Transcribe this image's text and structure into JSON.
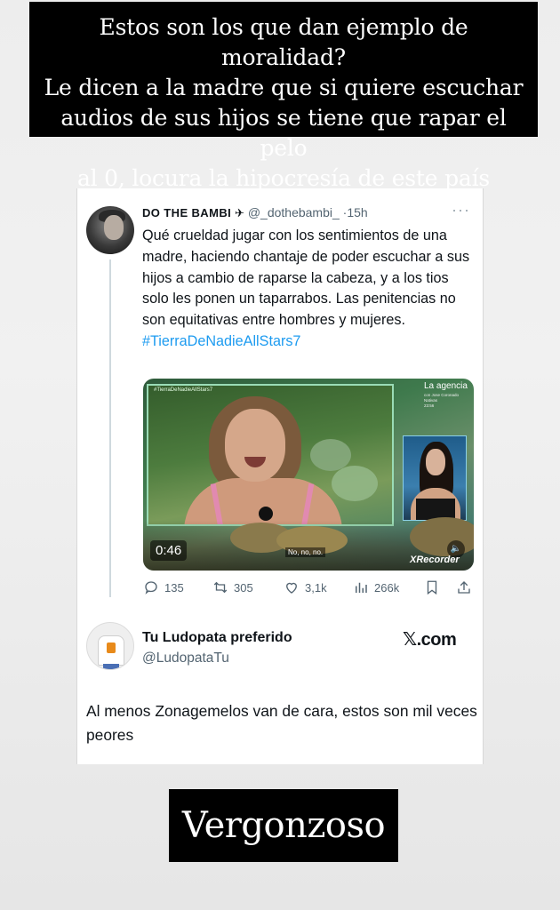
{
  "story": {
    "caption_lines": [
      "Estos son los que dan ejemplo de moralidad?",
      "Le dicen a la madre que si quiere escuchar",
      "audios de sus hijos se tiene que rapar el pelo",
      "al 0, locura la hipocresía de este país"
    ],
    "bottom_caption": "Vergonzoso"
  },
  "tweet": {
    "display_name": "DO THE BAMBI",
    "plane_glyph": "✈",
    "handle": "@_dothebambi_",
    "separator": "·",
    "time": "15h",
    "more_glyph": "···",
    "text": "Qué crueldad jugar con los sentimientos de una madre, haciendo chantaje de poder escuchar a sus hijos a cambio de raparse la cabeza, y a los tios solo les ponen un taparrabos. Las penitencias no son equitativas entre hombres y mujeres.",
    "hashtag": "#TierraDeNadieAllStars7",
    "media": {
      "inset_tag": "#TierraDeNadieAllStars7",
      "agency_title": "La agencia",
      "agency_sub_lines": [
        "con Jose Coronado",
        "Nativas",
        "23:56"
      ],
      "duration": "0:46",
      "subtitle": "No, no, no.",
      "watermark": "XRecorder"
    },
    "stats": {
      "replies": "135",
      "retweets": "305",
      "likes": "3,1k",
      "views": "266k"
    }
  },
  "reply": {
    "display_name": "Tu Ludopata preferido",
    "handle": "@LudopataTu",
    "brand": "𝕏.com",
    "text": "Al menos Zonagemelos van de cara, estos son mil veces peores"
  }
}
